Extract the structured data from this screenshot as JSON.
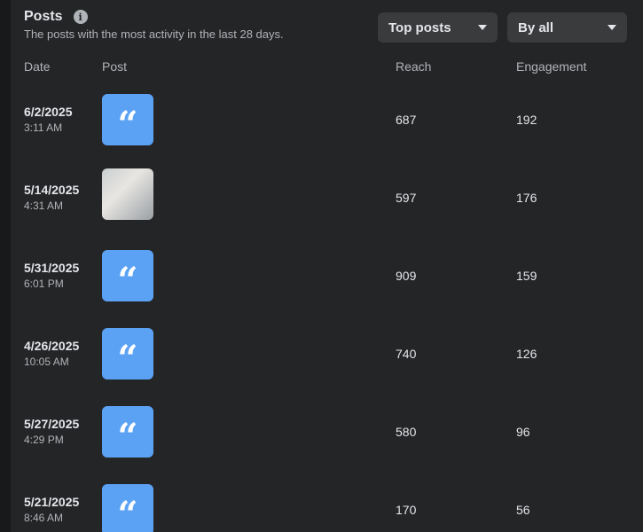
{
  "header": {
    "title": "Posts",
    "subtitle": "The posts with the most activity in the last 28 days.",
    "filter_sort": "Top posts",
    "filter_by": "By all"
  },
  "columns": {
    "date": "Date",
    "post": "Post",
    "reach": "Reach",
    "engagement": "Engagement"
  },
  "rows": [
    {
      "date": "6/2/2025",
      "time": "3:11 AM",
      "thumb": "quote-icon",
      "line1": "",
      "line2": "",
      "byline": "",
      "reach": "687",
      "engagement": "192"
    },
    {
      "date": "5/14/2025",
      "time": "4:31 AM",
      "thumb": "photo",
      "line1": "",
      "line2": "",
      "byline": "",
      "reach": "597",
      "engagement": "176"
    },
    {
      "date": "5/31/2025",
      "time": "6:01 PM",
      "thumb": "quote-icon",
      "line1": "",
      "line2": "",
      "byline": "",
      "reach": "909",
      "engagement": "159"
    },
    {
      "date": "4/26/2025",
      "time": "10:05 AM",
      "thumb": "quote-icon",
      "line1": "",
      "line2": "",
      "byline": "",
      "reach": "740",
      "engagement": "126"
    },
    {
      "date": "5/27/2025",
      "time": "4:29 PM",
      "thumb": "quote-icon",
      "line1": "",
      "line2": "",
      "byline": "",
      "reach": "580",
      "engagement": "96"
    },
    {
      "date": "5/21/2025",
      "time": "8:46 AM",
      "thumb": "quote-icon",
      "line1": "",
      "line2": "",
      "byline": "",
      "reach": "170",
      "engagement": "56"
    }
  ],
  "colors": {
    "background": "#18191a",
    "card": "#242526",
    "quote_tile": "#5ba2f5",
    "dropdown": "#3a3b3c"
  }
}
